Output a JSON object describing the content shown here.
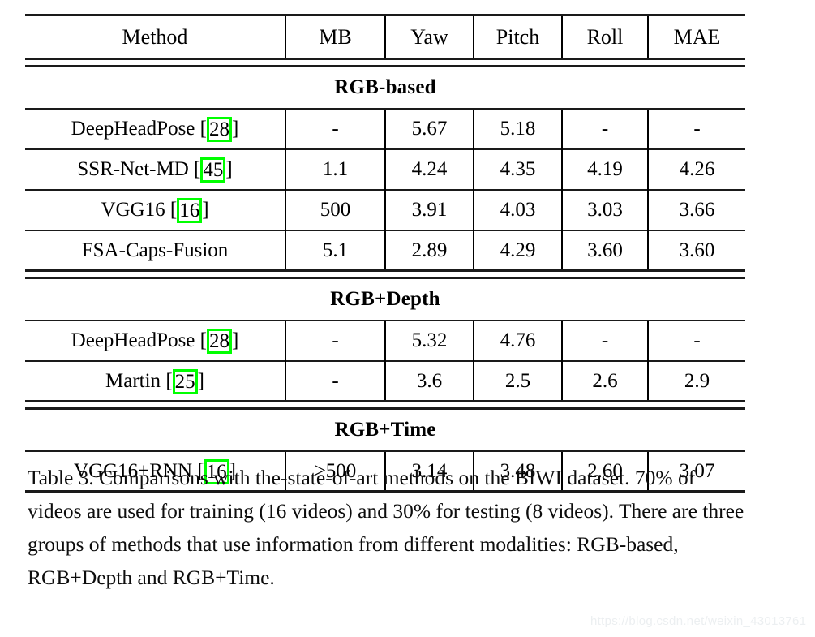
{
  "table": {
    "columns": [
      "Method",
      "MB",
      "Yaw",
      "Pitch",
      "Roll",
      "MAE"
    ],
    "sections": [
      {
        "title": "RGB-based",
        "rows": [
          {
            "method": "DeepHeadPose",
            "citation": "28",
            "highlighted": true,
            "mb": "-",
            "yaw": "5.67",
            "pitch": "5.18",
            "roll": "-",
            "mae": "-",
            "bold": []
          },
          {
            "method": "SSR-Net-MD",
            "citation": "45",
            "highlighted": true,
            "mb": "1.1",
            "yaw": "4.24",
            "pitch": "4.35",
            "roll": "4.19",
            "mae": "4.26",
            "bold": [
              "mb"
            ]
          },
          {
            "method": "VGG16",
            "citation": "16",
            "highlighted": true,
            "mb": "500",
            "yaw": "3.91",
            "pitch": "4.03",
            "roll": "3.03",
            "mae": "3.66",
            "bold": []
          },
          {
            "method": "FSA-Caps-Fusion",
            "citation": "",
            "highlighted": false,
            "mb": "5.1",
            "yaw": "2.89",
            "pitch": "4.29",
            "roll": "3.60",
            "mae": "3.60",
            "bold": [
              "yaw"
            ]
          }
        ]
      },
      {
        "title": "RGB+Depth",
        "rows": [
          {
            "method": "DeepHeadPose",
            "citation": "28",
            "highlighted": true,
            "mb": "-",
            "yaw": "5.32",
            "pitch": "4.76",
            "roll": "-",
            "mae": "-",
            "bold": []
          },
          {
            "method": "Martin",
            "citation": "25",
            "highlighted": true,
            "mb": "-",
            "yaw": "3.6",
            "pitch": "2.5",
            "roll": "2.6",
            "mae": "2.9",
            "bold": [
              "pitch",
              "roll"
            ]
          }
        ]
      },
      {
        "title": "RGB+Time",
        "rows": [
          {
            "method": "VGG16+RNN",
            "citation": "16",
            "highlighted": true,
            "mb": ">500",
            "yaw": "3.14",
            "pitch": "3.48",
            "roll": "2.60",
            "mae": "3.07",
            "bold": [
              "roll",
              "mae"
            ]
          }
        ]
      }
    ]
  },
  "caption": {
    "label": "Table 3.",
    "text": "Comparisons with the-state-of-art methods on the BIWI dataset. 70% of videos are used for training (16 videos) and 30% for testing (8 videos). There are three groups of methods that use information from different modalities: RGB-based, RGB+Depth and RGB+Time."
  },
  "watermark": {
    "text": "https://blog.csdn.net/weixin_43013761"
  },
  "colors": {
    "highlight": "#00ff00",
    "rule": "#1a1a1a",
    "text": "#000000",
    "watermark": "#eceff1"
  }
}
